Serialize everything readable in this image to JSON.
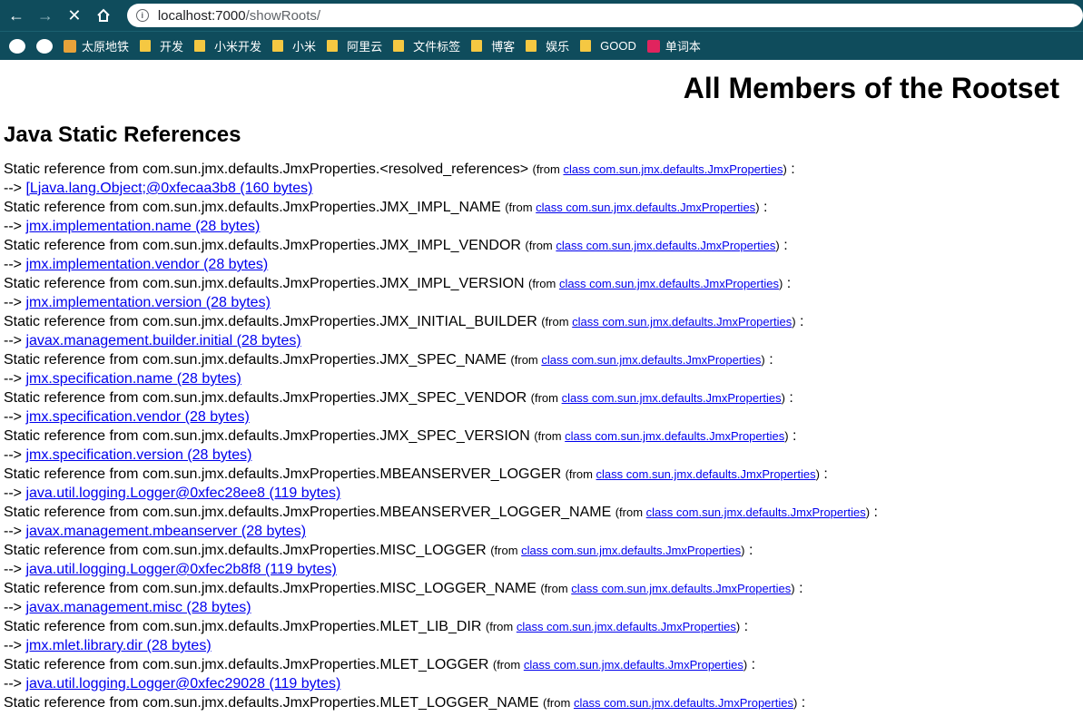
{
  "browser": {
    "url_host": "localhost:7000",
    "url_path": "/showRoots/",
    "bookmarks": [
      {
        "label": "",
        "icon": "extensions-icon"
      },
      {
        "label": "",
        "icon": "github-icon"
      },
      {
        "label": "太原地铁",
        "icon": "site-icon"
      },
      {
        "label": "开发",
        "icon": "folder-icon"
      },
      {
        "label": "小米开发",
        "icon": "folder-icon"
      },
      {
        "label": "小米",
        "icon": "folder-icon"
      },
      {
        "label": "阿里云",
        "icon": "folder-icon"
      },
      {
        "label": "文件标签",
        "icon": "folder-icon"
      },
      {
        "label": "博客",
        "icon": "folder-icon"
      },
      {
        "label": "娱乐",
        "icon": "folder-icon"
      },
      {
        "label": "GOOD",
        "icon": "folder-icon"
      },
      {
        "label": "单词本",
        "icon": "y-icon"
      }
    ]
  },
  "page": {
    "title": "All Members of the Rootset",
    "section_title": "Java Static References",
    "prefix": "Static reference from ",
    "from_open": "(from ",
    "from_close": ")",
    "colon": " :",
    "arrow": "--> ",
    "class_link": "class com.sun.jmx.defaults.JmxProperties",
    "entries": [
      {
        "field": "com.sun.jmx.defaults.JmxProperties.<resolved_references>",
        "target": "[Ljava.lang.Object;@0xfecaa3b8 (160 bytes)"
      },
      {
        "field": "com.sun.jmx.defaults.JmxProperties.JMX_IMPL_NAME",
        "target": "jmx.implementation.name (28 bytes)"
      },
      {
        "field": "com.sun.jmx.defaults.JmxProperties.JMX_IMPL_VENDOR",
        "target": "jmx.implementation.vendor (28 bytes)"
      },
      {
        "field": "com.sun.jmx.defaults.JmxProperties.JMX_IMPL_VERSION",
        "target": "jmx.implementation.version (28 bytes)"
      },
      {
        "field": "com.sun.jmx.defaults.JmxProperties.JMX_INITIAL_BUILDER",
        "target": "javax.management.builder.initial (28 bytes)"
      },
      {
        "field": "com.sun.jmx.defaults.JmxProperties.JMX_SPEC_NAME",
        "target": "jmx.specification.name (28 bytes)"
      },
      {
        "field": "com.sun.jmx.defaults.JmxProperties.JMX_SPEC_VENDOR",
        "target": "jmx.specification.vendor (28 bytes)"
      },
      {
        "field": "com.sun.jmx.defaults.JmxProperties.JMX_SPEC_VERSION",
        "target": "jmx.specification.version (28 bytes)"
      },
      {
        "field": "com.sun.jmx.defaults.JmxProperties.MBEANSERVER_LOGGER",
        "target": "java.util.logging.Logger@0xfec28ee8 (119 bytes)"
      },
      {
        "field": "com.sun.jmx.defaults.JmxProperties.MBEANSERVER_LOGGER_NAME",
        "target": "javax.management.mbeanserver (28 bytes)"
      },
      {
        "field": "com.sun.jmx.defaults.JmxProperties.MISC_LOGGER",
        "target": "java.util.logging.Logger@0xfec2b8f8 (119 bytes)"
      },
      {
        "field": "com.sun.jmx.defaults.JmxProperties.MISC_LOGGER_NAME",
        "target": "javax.management.misc (28 bytes)"
      },
      {
        "field": "com.sun.jmx.defaults.JmxProperties.MLET_LIB_DIR",
        "target": "jmx.mlet.library.dir (28 bytes)"
      },
      {
        "field": "com.sun.jmx.defaults.JmxProperties.MLET_LOGGER",
        "target": "java.util.logging.Logger@0xfec29028 (119 bytes)"
      },
      {
        "field": "com.sun.jmx.defaults.JmxProperties.MLET_LOGGER_NAME",
        "target": ""
      }
    ]
  },
  "colors": {
    "chrome": "#0f4c5c",
    "link": "#0000ee",
    "folder": "#f5c842"
  }
}
